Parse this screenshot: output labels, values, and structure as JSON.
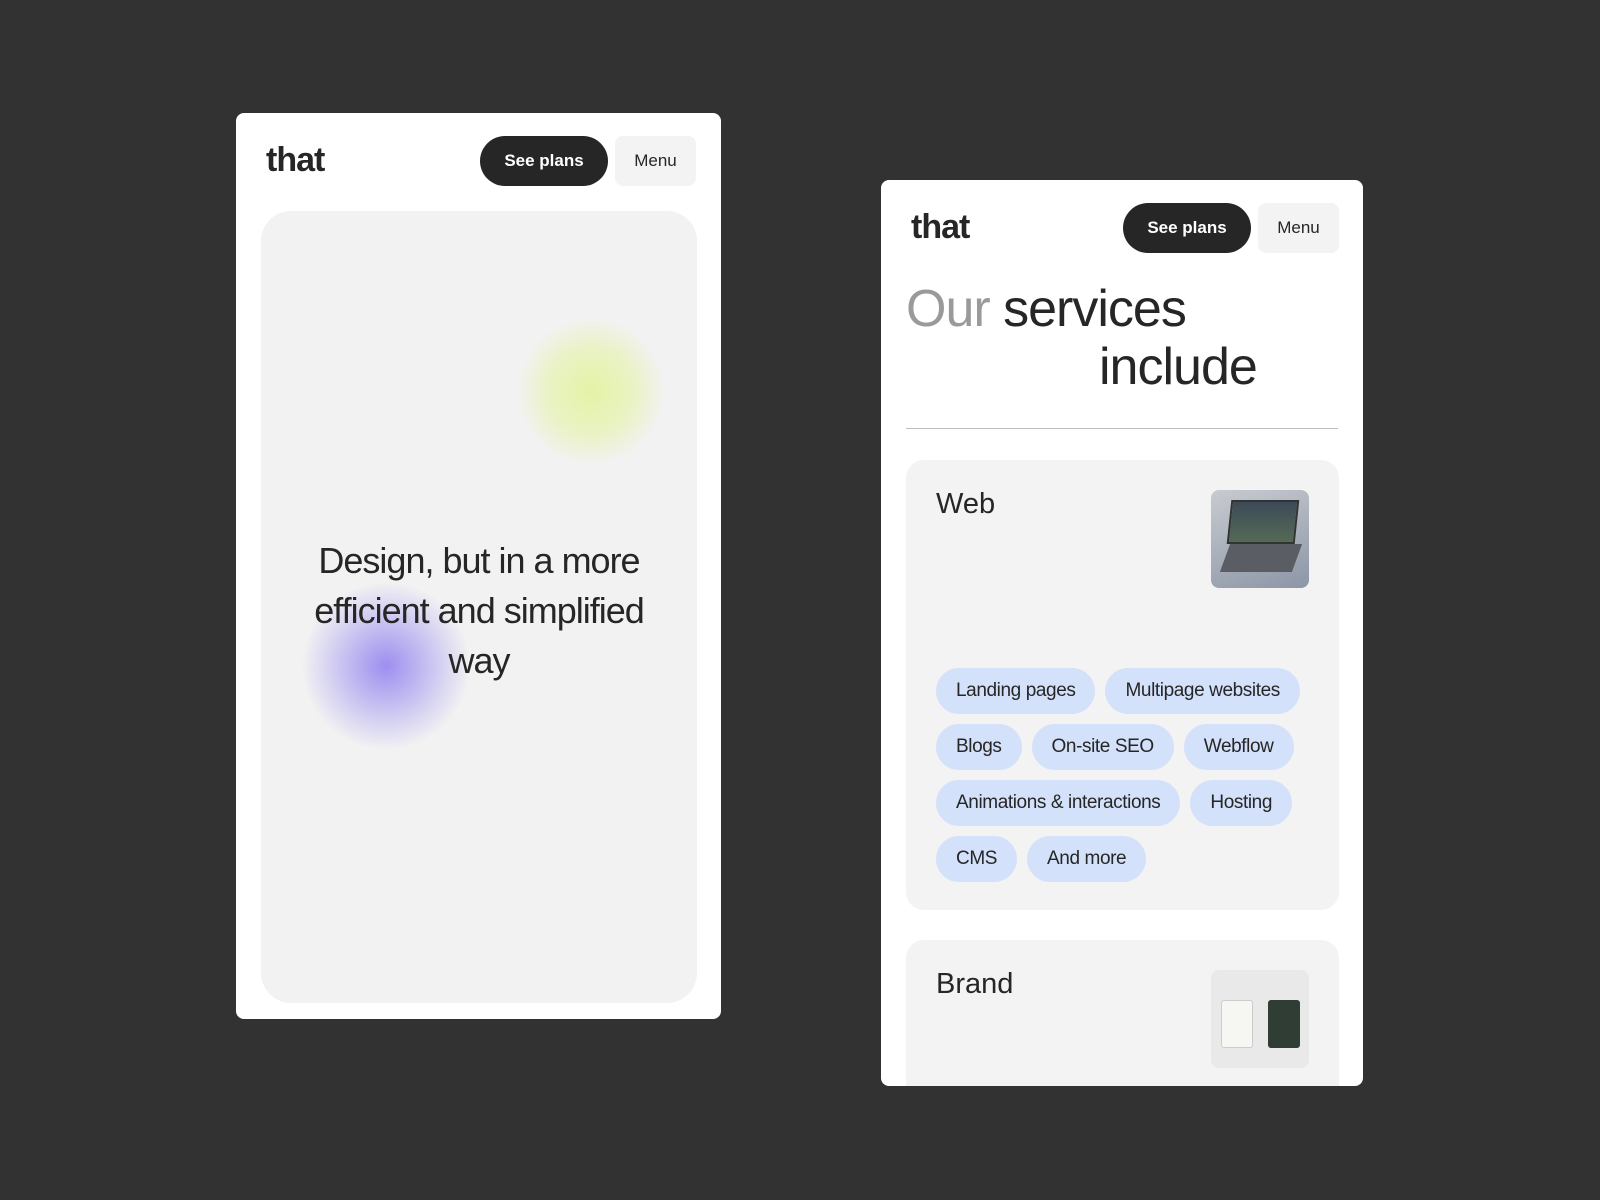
{
  "screen1": {
    "logo": "that",
    "see_plans": "See plans",
    "menu": "Menu",
    "hero": "Design, but in a more efficient and simplified way"
  },
  "screen2": {
    "logo": "that",
    "see_plans": "See plans",
    "menu": "Menu",
    "heading_muted": "Our",
    "heading_1": "services",
    "heading_2": "include",
    "services": [
      {
        "title": "Web",
        "tags": [
          "Landing pages",
          "Multipage websites",
          "Blogs",
          "On-site SEO",
          "Webflow",
          "Animations & interactions",
          "Hosting",
          "CMS",
          "And more"
        ]
      },
      {
        "title": "Brand"
      }
    ]
  },
  "colors": {
    "background": "#323232",
    "primary_button": "#262626",
    "tag": "#d3e1fa",
    "card": "#f3f3f3"
  }
}
